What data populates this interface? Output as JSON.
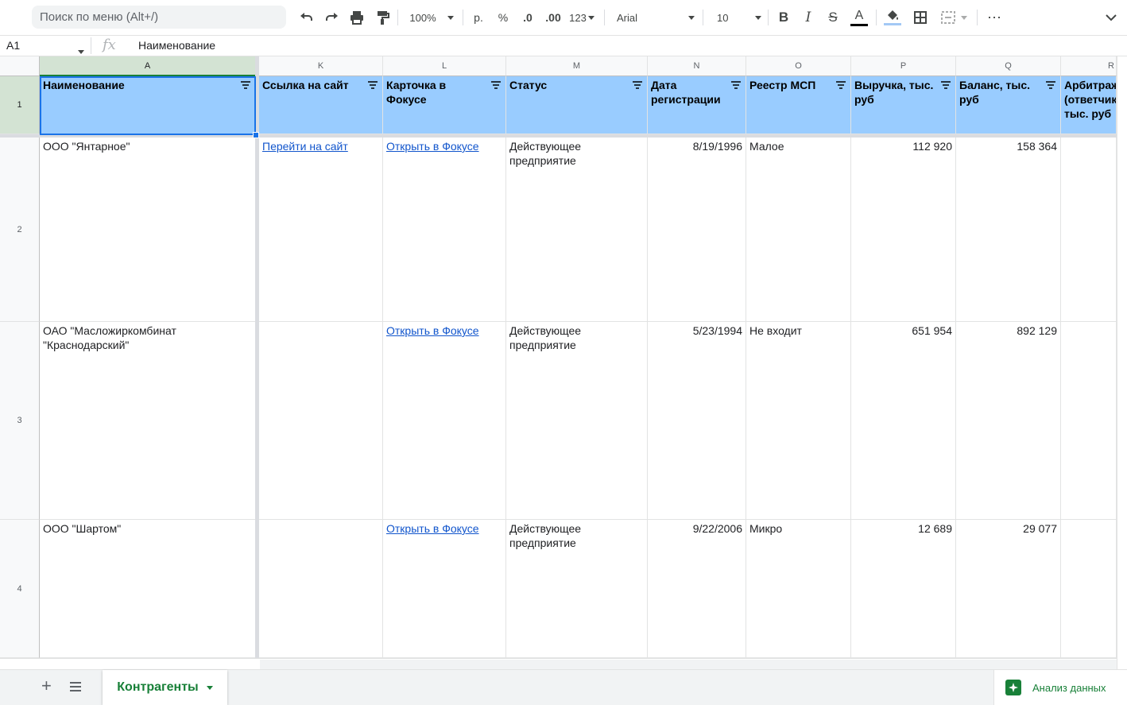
{
  "toolbar": {
    "search_placeholder": "Поиск по меню (Alt+/)",
    "zoom": "100%",
    "currency": "р.",
    "percent": "%",
    "decrease_decimals": ".0",
    "increase_decimals": ".00",
    "more_formats": "123",
    "font": "Arial",
    "font_size": "10",
    "more": "⋯"
  },
  "formula_bar": {
    "cell_ref": "A1",
    "fx": "fx",
    "value": "Наименование"
  },
  "columns": [
    "A",
    "K",
    "L",
    "M",
    "N",
    "O",
    "P",
    "Q",
    "R"
  ],
  "rows": [
    "1",
    "2",
    "3",
    "4"
  ],
  "header": {
    "name": "Наименование",
    "site_link": "Ссылка на сайт",
    "focus_card": "Карточка в Фокусе",
    "status": "Статус",
    "reg_date": "Дата регистрации",
    "msp_registry": "Реестр МСП",
    "revenue": "Выручка, тыс. руб",
    "balance": "Баланс, тыс. руб",
    "arbitration": "Арбитраж (ответчик) тыс. руб"
  },
  "data": [
    {
      "name": "ООО \"Янтарное\"",
      "site_link": "Перейти на сайт",
      "focus_card": "Открыть в Фокусе",
      "status": "Действующее предприятие",
      "reg_date": "8/19/1996",
      "msp_registry": "Малое",
      "revenue": "112 920",
      "balance": "158 364"
    },
    {
      "name": "ОАО \"Масложиркомбинат \"Краснодарский\"",
      "site_link": "",
      "focus_card": "Открыть в Фокусе",
      "status": "Действующее предприятие",
      "reg_date": "5/23/1994",
      "msp_registry": "Не входит",
      "revenue": "651 954",
      "balance": "892 129"
    },
    {
      "name": "ООО \"Шартом\"",
      "site_link": "",
      "focus_card": "Открыть в Фокусе",
      "status": "Действующее предприятие",
      "reg_date": "9/22/2006",
      "msp_registry": "Микро",
      "revenue": "12 689",
      "balance": "29 077"
    }
  ],
  "sheets": {
    "add": "+",
    "active_tab": "Контрагенты"
  },
  "explore": {
    "label": "Анализ данных"
  },
  "colors": {
    "header_fill": "#99ccff",
    "selection": "#1a73e8",
    "accent": "#188038",
    "link": "#1155cc"
  }
}
